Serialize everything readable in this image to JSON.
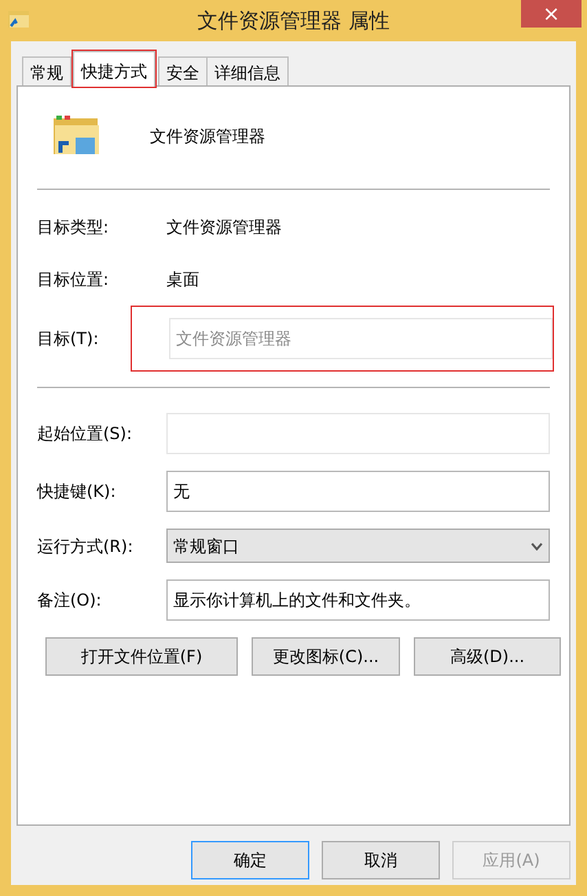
{
  "window": {
    "title": "文件资源管理器 属性",
    "close": "×"
  },
  "tabs": [
    {
      "label": "常规",
      "selected": false,
      "highlighted": false
    },
    {
      "label": "快捷方式",
      "selected": true,
      "highlighted": true
    },
    {
      "label": "安全",
      "selected": false,
      "highlighted": false
    },
    {
      "label": "详细信息",
      "selected": false,
      "highlighted": false
    }
  ],
  "shortcut_name": "文件资源管理器",
  "info": [
    {
      "label": "目标类型:",
      "value": "文件资源管理器"
    },
    {
      "label": "目标位置:",
      "value": "桌面"
    }
  ],
  "target": {
    "label": "目标(T):",
    "value": "文件资源管理器",
    "disabled": true,
    "highlighted": true
  },
  "fields": [
    {
      "kind": "text",
      "label": "起始位置(S):",
      "disabled": true
    },
    {
      "kind": "text",
      "label": "快捷键(K):",
      "value": "无",
      "disabled": false
    },
    {
      "kind": "select",
      "label": "运行方式(R):",
      "value": "常规窗口",
      "disabled": false
    },
    {
      "kind": "text",
      "label": "备注(O):",
      "value": "显示你计算机上的文件和文件夹。",
      "disabled": false
    }
  ],
  "actions": [
    "打开文件位置(F)",
    "更改图标(C)...",
    "高级(D)..."
  ],
  "buttons": [
    {
      "label": "确定",
      "default": true,
      "disabled": false
    },
    {
      "label": "取消",
      "default": false,
      "disabled": false
    },
    {
      "label": "应用(A)",
      "default": false,
      "disabled": true
    }
  ]
}
